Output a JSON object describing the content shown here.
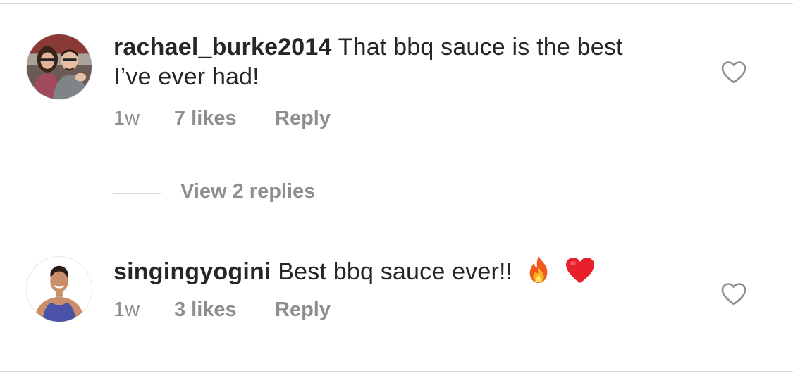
{
  "comments": [
    {
      "username": "rachael_burke2014",
      "text": "That bbq sauce is the best I’ve ever had!",
      "time": "1w",
      "likes": "7 likes",
      "reply_label": "Reply",
      "liked": false
    },
    {
      "username": "singingyogini",
      "text": "Best bbq sauce ever!!",
      "emojis": [
        "fire",
        "red-heart"
      ],
      "time": "1w",
      "likes": "3 likes",
      "reply_label": "Reply",
      "liked": false
    }
  ],
  "view_replies_label": "View 2 replies",
  "colors": {
    "text": "#262626",
    "secondary": "#8e8e8e",
    "divider": "#dbdbdb"
  }
}
